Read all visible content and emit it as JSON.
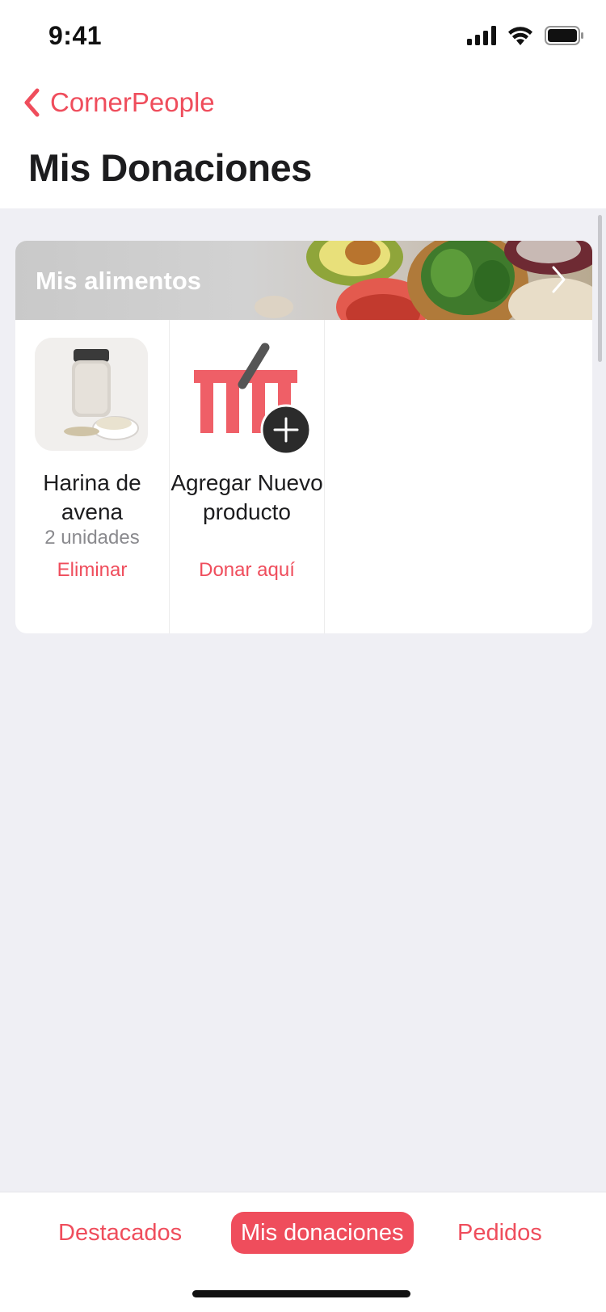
{
  "status_bar": {
    "time": "9:41"
  },
  "nav": {
    "back_label": "CornerPeople",
    "title": "Mis Donaciones"
  },
  "card": {
    "banner_title": "Mis alimentos",
    "items": [
      {
        "name": "Harina de avena",
        "quantity": "2 unidades",
        "action": "Eliminar"
      },
      {
        "name": "Agregar Nuevo producto",
        "action": "Donar aquí"
      }
    ]
  },
  "tabbar": {
    "tabs": [
      {
        "label": "Destacados",
        "active": false
      },
      {
        "label": "Mis donaciones",
        "active": true
      },
      {
        "label": "Pedidos",
        "active": false
      }
    ]
  },
  "colors": {
    "accent": "#ef4d5c",
    "background": "#efeff4",
    "text": "#1c1c1e"
  }
}
